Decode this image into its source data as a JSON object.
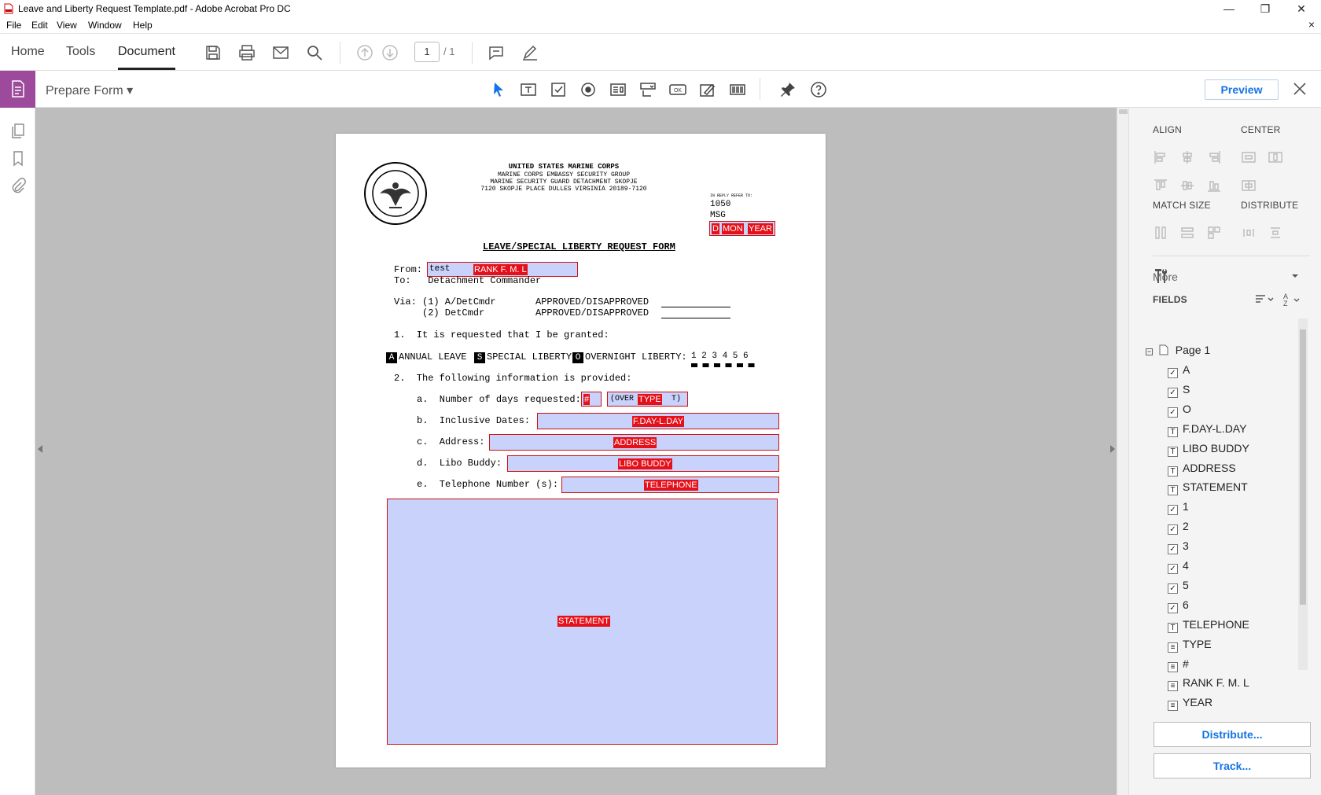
{
  "window": {
    "title": "Leave and Liberty Request Template.pdf - Adobe Acrobat Pro DC",
    "minimize": "—",
    "maximize": "❐",
    "close": "✕"
  },
  "menu": {
    "file": "File",
    "edit": "Edit",
    "view": "View",
    "window": "Window",
    "help": "Help",
    "doc_close": "×"
  },
  "nav": {
    "home": "Home",
    "tools": "Tools",
    "document": "Document",
    "page_current": "1",
    "page_total": "/ 1"
  },
  "toolbar": {
    "title": "Prepare Form ▾",
    "preview": "Preview"
  },
  "panel": {
    "align": "ALIGN",
    "center": "CENTER",
    "match_size": "MATCH SIZE",
    "distribute": "DISTRIBUTE",
    "more": "More",
    "fields": "FIELDS",
    "page_node": "Page 1",
    "distribute_btn": "Distribute...",
    "track_btn": "Track...",
    "fields_list": [
      {
        "type": "check",
        "label": "A"
      },
      {
        "type": "check",
        "label": "S"
      },
      {
        "type": "check",
        "label": "O"
      },
      {
        "type": "text",
        "label": "F.DAY-L.DAY"
      },
      {
        "type": "text",
        "label": "LIBO BUDDY"
      },
      {
        "type": "text",
        "label": "ADDRESS"
      },
      {
        "type": "text",
        "label": "STATEMENT"
      },
      {
        "type": "check",
        "label": "1"
      },
      {
        "type": "check",
        "label": "2"
      },
      {
        "type": "check",
        "label": "3"
      },
      {
        "type": "check",
        "label": "4"
      },
      {
        "type": "check",
        "label": "5"
      },
      {
        "type": "check",
        "label": "6"
      },
      {
        "type": "text",
        "label": "TELEPHONE"
      },
      {
        "type": "list",
        "label": "TYPE"
      },
      {
        "type": "list",
        "label": "#"
      },
      {
        "type": "list",
        "label": "RANK F. M. L"
      },
      {
        "type": "list",
        "label": "YEAR"
      }
    ]
  },
  "doc": {
    "h1": "UNITED STATES MARINE CORPS",
    "h2": "MARINE CORPS EMBASSY SECURITY GROUP",
    "h3": "MARINE SECURITY GUARD DETACHMENT SKOPJE",
    "h4": "7120 SKOPJE PLACE DULLES VIRGINIA 20189-7120",
    "reply": "IN REPLY REFER TO:",
    "ref1": "1050",
    "ref2": "MSG",
    "form_title": "LEAVE/SPECIAL LIBERTY REQUEST FORM",
    "from_label": "From:",
    "from_value": "test",
    "to_line": "To:   Detachment Commander",
    "via1": "Via: (1) A/DetCmdr       APPROVED/DISAPPROVED",
    "via2": "     (2) DetCmdr         APPROVED/DISAPPROVED",
    "p1": "1.  It is requested that I be granted:",
    "opt_annual": "ANNUAL LEAVE",
    "opt_special": "SPECIAL LIBERTY",
    "opt_overnight": "OVERNIGHT LIBERTY:",
    "nums": "1 2 3 4 5 6",
    "p2": "2.  The following information is provided:",
    "a": "a.  Number of days requested:",
    "b": "b.  Inclusive Dates:",
    "c": "c.  Address:",
    "d": "d.  Libo Buddy:",
    "e": "e.  Telephone Number (s):",
    "type_text": "(OVER        T)",
    "seal_top": "DEPARTMENT OF DEFENSE",
    "seal_bottom": "UNITED STATES OF AMERICA"
  },
  "fields": {
    "d": "D",
    "mon": "MON",
    "year": "YEAR",
    "rank": "RANK F. M. L",
    "num": "#",
    "type": "TYPE",
    "dates": "F.DAY-L.DAY",
    "address": "ADDRESS",
    "libo": "LIBO BUDDY",
    "telephone": "TELEPHONE",
    "statement": "STATEMENT",
    "cb_a": "A",
    "cb_s": "S",
    "cb_o": "O"
  }
}
